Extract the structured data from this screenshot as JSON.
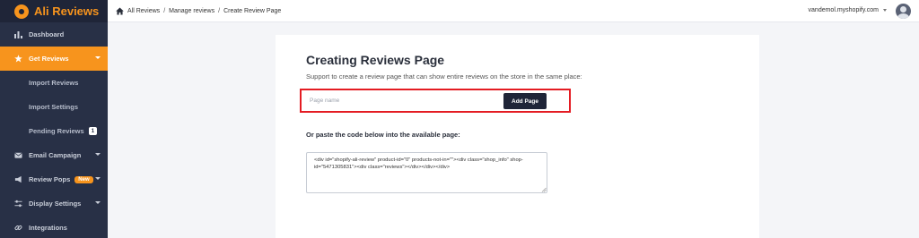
{
  "app": {
    "name": "Ali Reviews"
  },
  "sidebar": {
    "items": [
      {
        "label": "Dashboard",
        "icon": "bar-chart-icon"
      },
      {
        "label": "Get Reviews",
        "icon": "star-icon",
        "active": true
      },
      {
        "label": "Import Reviews"
      },
      {
        "label": "Import Settings"
      },
      {
        "label": "Pending Reviews",
        "badge": "1"
      },
      {
        "label": "Email Campaign",
        "icon": "envelope-icon"
      },
      {
        "label": "Review Pops",
        "icon": "megaphone-icon",
        "badge": "New"
      },
      {
        "label": "Display Settings",
        "icon": "sliders-icon"
      },
      {
        "label": "Integrations",
        "icon": "link-icon"
      }
    ]
  },
  "breadcrumb": [
    "All Reviews",
    "Manage reviews",
    "Create Review Page"
  ],
  "account": {
    "domain": "vandemol.myshopify.com"
  },
  "card": {
    "title": "Creating Reviews Page",
    "subtitle": "Support to create a review page that can show entire reviews on the store in the same place:",
    "input_placeholder": "Page name",
    "add_button": "Add Page",
    "paste_label": "Or paste the code below into the available page:",
    "code": "<div id=\"shopify-ali-review\" product-id=\"0\" products-not-in=\"\"><div class=\"shop_info\" shop-id=\"5471305831\"><div class=\"reviews\"></div></div></div>"
  },
  "colors": {
    "accent": "#f7941d",
    "sidebar": "#283046",
    "highlight": "#e41c23"
  }
}
